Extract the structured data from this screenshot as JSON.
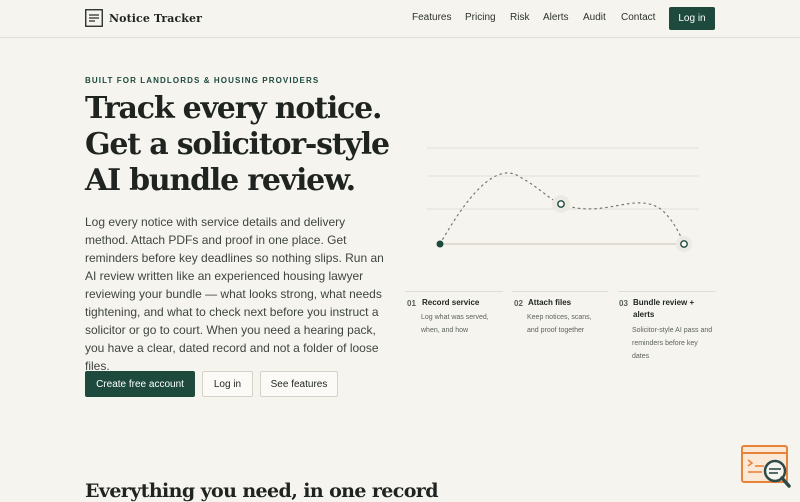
{
  "brand": {
    "name": "Notice Tracker",
    "icon": "document-lines-icon"
  },
  "nav": {
    "links": [
      "Features",
      "Pricing",
      "Risk",
      "Alerts",
      "Audit",
      "Contact"
    ],
    "login_label": "Log in"
  },
  "hero": {
    "eyebrow": "BUILT FOR LANDLORDS & HOUSING PROVIDERS",
    "headline_lines": [
      "Track every notice.",
      "Get a solicitor-style",
      "AI bundle review."
    ],
    "body": "Log every notice with service details and delivery method. Attach PDFs and proof in one place. Get reminders before key deadlines so nothing slips. Run an AI review written like an experienced housing lawyer reviewing your bundle — what looks strong, what needs tightening, and what to check next before you instruct a solicitor or go to court. When you need a hearing pack, you have a clear, dated record and not a folder of loose files.",
    "cta_primary": "Create free account",
    "cta_login": "Log in",
    "cta_features": "See features"
  },
  "steps": [
    {
      "number": "01",
      "title": "Record service",
      "desc": "Log what was served, when, and how"
    },
    {
      "number": "02",
      "title": "Attach files",
      "desc": "Keep notices, scans, and proof together"
    },
    {
      "number": "03",
      "title": "Bundle review + alerts",
      "desc": "Solicitor-style AI pass and reminders before key dates"
    }
  ],
  "section": {
    "title": "Everything you need, in one record"
  },
  "colors": {
    "accent": "#1d4a3d",
    "background": "#f6f4ef",
    "text": "#1f2421",
    "widget": "#e8843a"
  }
}
